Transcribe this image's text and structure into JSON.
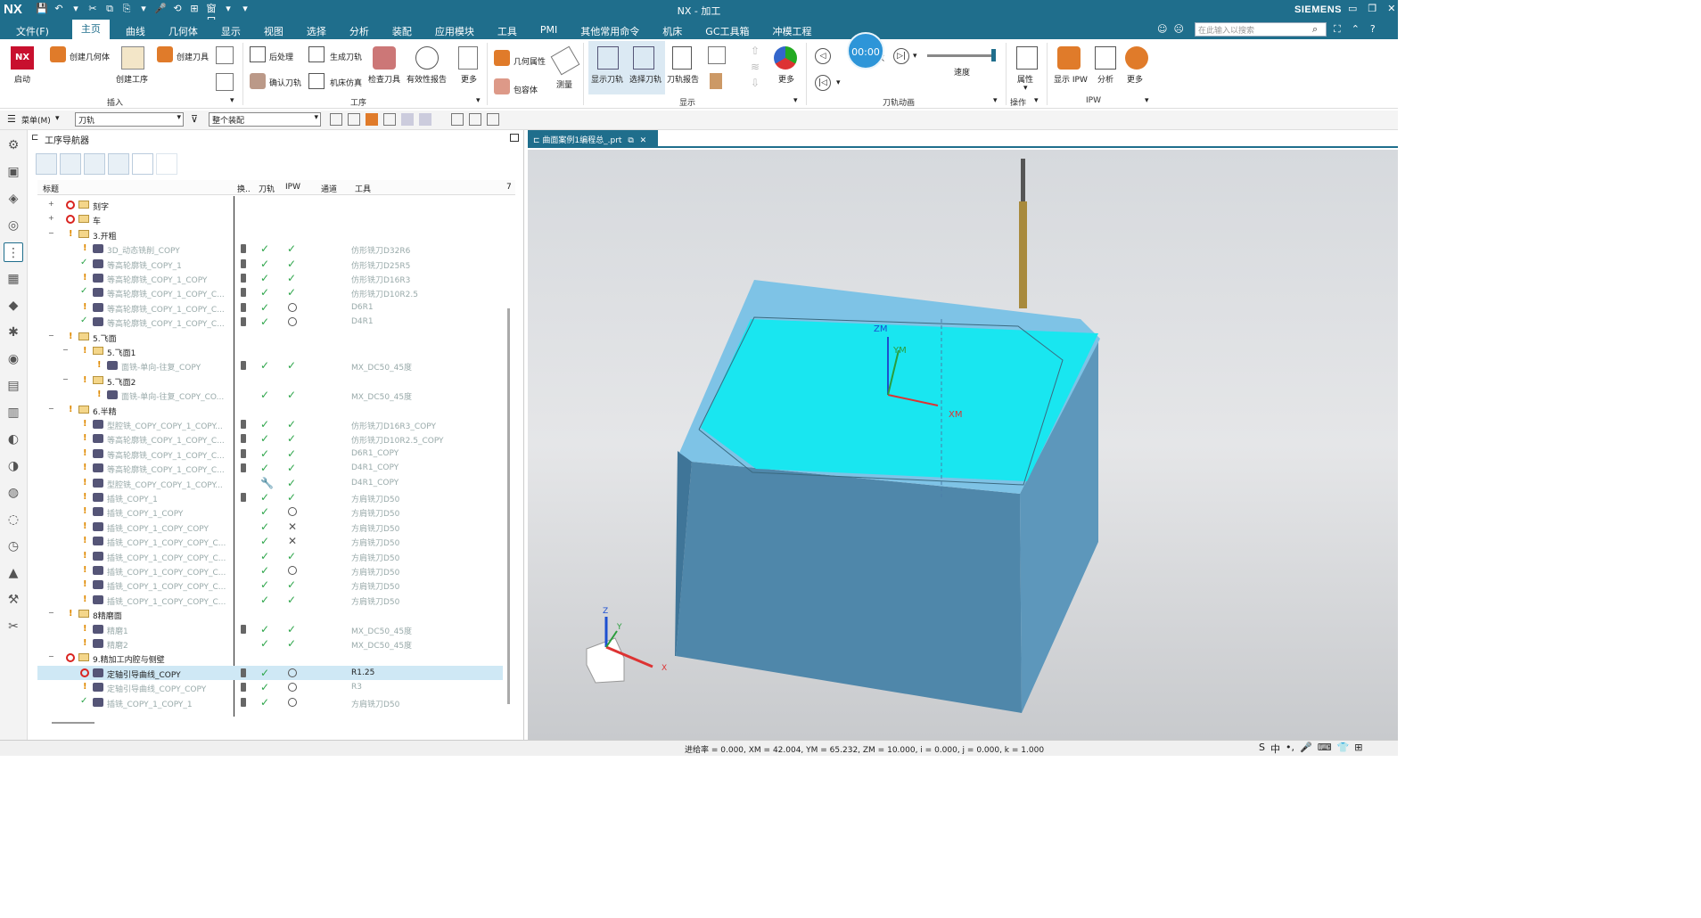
{
  "app": {
    "logo": "NX",
    "title": "NX - 加工",
    "brand": "SIEMENS",
    "window_controls": [
      "▭",
      "❐",
      "✕"
    ]
  },
  "quick_access": [
    "💾",
    "↶",
    "▾",
    "✂",
    "⧉",
    "⎘",
    "▾",
    "🎤",
    "⟲",
    "⊞",
    "窗口",
    "▾",
    "▾"
  ],
  "menu": {
    "items": [
      "文件(F)",
      "主页",
      "曲线",
      "几何体",
      "显示",
      "视图",
      "选择",
      "分析",
      "装配",
      "应用模块",
      "工具",
      "PMI",
      "其他常用命令",
      "机床",
      "GC工具箱",
      "冲模工程"
    ],
    "active": "主页",
    "timer": "00:00",
    "search_placeholder": "在此输入以搜索",
    "right_icons": [
      "☺",
      "☹"
    ],
    "right_icons2": [
      "⛶",
      "⌃",
      "?"
    ]
  },
  "ribbon": {
    "buttons": {
      "start": "启动",
      "create_geometry": "创建几何体",
      "create_operation": "创建工序",
      "create_tool": "创建刀具",
      "postprocess": "后处理",
      "generate_toolpath": "生成刀轨",
      "confirm_toolpath": "确认刀轨",
      "machine_sim": "机床仿真",
      "check_tool": "检查刀具",
      "valid_report": "有效性报告",
      "more1": "更多",
      "geom_props": "几何属性",
      "measure": "测量",
      "envelope": "包容体",
      "show_toolpath": "显示刀轨",
      "select_toolpath": "选择刀轨",
      "toolpath_report": "刀轨报告",
      "more2": "更多",
      "play": "播放",
      "speed": "速度",
      "properties": "属性",
      "show_ipw": "显示 IPW",
      "analyze": "分析",
      "more3": "更多"
    },
    "groups": {
      "insert": "插入",
      "operation": "工序",
      "display": "显示",
      "animation": "刀轨动画",
      "actions": "操作",
      "ipw": "IPW"
    }
  },
  "filterbar": {
    "menu": "菜单(M)",
    "filter1": "刀轨",
    "filter2": "整个装配"
  },
  "navigator": {
    "title": "工序导航器",
    "columns": [
      "标题",
      "换..",
      "刀轨",
      "IPW",
      "通道",
      "工具"
    ],
    "rows": [
      {
        "indent": 1,
        "expand": "+",
        "status": "noop",
        "icon": "fold",
        "name": "刻字",
        "dim": false,
        "bar": false,
        "path": "",
        "ipw": "",
        "tool": ""
      },
      {
        "indent": 1,
        "expand": "+",
        "status": "noop",
        "icon": "fold",
        "name": "车",
        "dim": false,
        "bar": false,
        "path": "",
        "ipw": "",
        "tool": ""
      },
      {
        "indent": 1,
        "expand": "−",
        "status": "exc",
        "icon": "fold",
        "name": "3.开粗",
        "dim": false,
        "bar": false,
        "path": "",
        "ipw": "",
        "tool": ""
      },
      {
        "indent": 2,
        "expand": "",
        "status": "exc",
        "icon": "op",
        "name": "3D_动态铣削_COPY",
        "dim": true,
        "bar": true,
        "path": "check",
        "ipw": "check",
        "tool": "仿形铣刀D32R6"
      },
      {
        "indent": 2,
        "expand": "",
        "status": "ok",
        "icon": "op",
        "name": "等高轮廓铣_COPY_1",
        "dim": true,
        "bar": true,
        "path": "check",
        "ipw": "check",
        "tool": "仿形铣刀D25R5"
      },
      {
        "indent": 2,
        "expand": "",
        "status": "exc",
        "icon": "op",
        "name": "等高轮廓铣_COPY_1_COPY",
        "dim": true,
        "bar": true,
        "path": "check",
        "ipw": "check",
        "tool": "仿形铣刀D16R3"
      },
      {
        "indent": 2,
        "expand": "",
        "status": "ok",
        "icon": "op",
        "name": "等高轮廓铣_COPY_1_COPY_C...",
        "dim": true,
        "bar": true,
        "path": "check",
        "ipw": "check",
        "tool": "仿形铣刀D10R2.5"
      },
      {
        "indent": 2,
        "expand": "",
        "status": "exc",
        "icon": "op",
        "name": "等高轮廓铣_COPY_1_COPY_C...",
        "dim": true,
        "bar": true,
        "path": "check",
        "ipw": "clock",
        "tool": "D6R1"
      },
      {
        "indent": 2,
        "expand": "",
        "status": "ok",
        "icon": "op",
        "name": "等高轮廓铣_COPY_1_COPY_C...",
        "dim": true,
        "bar": true,
        "path": "check",
        "ipw": "clock",
        "tool": "D4R1"
      },
      {
        "indent": 1,
        "expand": "−",
        "status": "exc",
        "icon": "fold",
        "name": "5.飞面",
        "dim": false,
        "bar": false,
        "path": "",
        "ipw": "",
        "tool": ""
      },
      {
        "indent": 2,
        "expand": "−",
        "status": "exc",
        "icon": "fold",
        "name": "5.飞面1",
        "dim": false,
        "bar": false,
        "path": "",
        "ipw": "",
        "tool": ""
      },
      {
        "indent": 3,
        "expand": "",
        "status": "exc",
        "icon": "op",
        "name": "面铣-单向-往复_COPY",
        "dim": true,
        "bar": true,
        "path": "check",
        "ipw": "check",
        "tool": "MX_DC50_45度"
      },
      {
        "indent": 2,
        "expand": "−",
        "status": "exc",
        "icon": "fold",
        "name": "5.飞面2",
        "dim": false,
        "bar": false,
        "path": "",
        "ipw": "",
        "tool": ""
      },
      {
        "indent": 3,
        "expand": "",
        "status": "exc",
        "icon": "op",
        "name": "面铣-单向-往复_COPY_CO...",
        "dim": true,
        "bar": false,
        "path": "check",
        "ipw": "check",
        "tool": "MX_DC50_45度"
      },
      {
        "indent": 1,
        "expand": "−",
        "status": "exc",
        "icon": "fold",
        "name": "6.半精",
        "dim": false,
        "bar": false,
        "path": "",
        "ipw": "",
        "tool": ""
      },
      {
        "indent": 2,
        "expand": "",
        "status": "exc",
        "icon": "op",
        "name": "型腔铣_COPY_COPY_1_COPY...",
        "dim": true,
        "bar": true,
        "path": "check",
        "ipw": "check",
        "tool": "仿形铣刀D16R3_COPY"
      },
      {
        "indent": 2,
        "expand": "",
        "status": "exc",
        "icon": "op",
        "name": "等高轮廓铣_COPY_1_COPY_C...",
        "dim": true,
        "bar": true,
        "path": "check",
        "ipw": "check",
        "tool": "仿形铣刀D10R2.5_COPY"
      },
      {
        "indent": 2,
        "expand": "",
        "status": "exc",
        "icon": "op",
        "name": "等高轮廓铣_COPY_1_COPY_C...",
        "dim": true,
        "bar": true,
        "path": "check",
        "ipw": "check",
        "tool": "D6R1_COPY"
      },
      {
        "indent": 2,
        "expand": "",
        "status": "exc",
        "icon": "op",
        "name": "等高轮廓铣_COPY_1_COPY_C...",
        "dim": true,
        "bar": true,
        "path": "check",
        "ipw": "check",
        "tool": "D4R1_COPY"
      },
      {
        "indent": 2,
        "expand": "",
        "status": "exc",
        "icon": "op",
        "name": "型腔铣_COPY_COPY_1_COPY...",
        "dim": true,
        "bar": false,
        "path": "wrench",
        "ipw": "check",
        "tool": "D4R1_COPY"
      },
      {
        "indent": 2,
        "expand": "",
        "status": "exc",
        "icon": "op",
        "name": "插铣_COPY_1",
        "dim": true,
        "bar": true,
        "path": "check",
        "ipw": "check",
        "tool": "方肩铣刀D50"
      },
      {
        "indent": 2,
        "expand": "",
        "status": "exc",
        "icon": "op",
        "name": "插铣_COPY_1_COPY",
        "dim": true,
        "bar": false,
        "path": "check",
        "ipw": "clock",
        "tool": "方肩铣刀D50"
      },
      {
        "indent": 2,
        "expand": "",
        "status": "exc",
        "icon": "op",
        "name": "插铣_COPY_1_COPY_COPY",
        "dim": true,
        "bar": false,
        "path": "check",
        "ipw": "x",
        "tool": "方肩铣刀D50"
      },
      {
        "indent": 2,
        "expand": "",
        "status": "exc",
        "icon": "op",
        "name": "插铣_COPY_1_COPY_COPY_C...",
        "dim": true,
        "bar": false,
        "path": "check",
        "ipw": "x",
        "tool": "方肩铣刀D50"
      },
      {
        "indent": 2,
        "expand": "",
        "status": "exc",
        "icon": "op",
        "name": "插铣_COPY_1_COPY_COPY_C...",
        "dim": true,
        "bar": false,
        "path": "check",
        "ipw": "check",
        "tool": "方肩铣刀D50"
      },
      {
        "indent": 2,
        "expand": "",
        "status": "exc",
        "icon": "op",
        "name": "插铣_COPY_1_COPY_COPY_C...",
        "dim": true,
        "bar": false,
        "path": "check",
        "ipw": "clock",
        "tool": "方肩铣刀D50"
      },
      {
        "indent": 2,
        "expand": "",
        "status": "exc",
        "icon": "op",
        "name": "插铣_COPY_1_COPY_COPY_C...",
        "dim": true,
        "bar": false,
        "path": "check",
        "ipw": "check",
        "tool": "方肩铣刀D50"
      },
      {
        "indent": 2,
        "expand": "",
        "status": "exc",
        "icon": "op",
        "name": "插铣_COPY_1_COPY_COPY_C...",
        "dim": true,
        "bar": false,
        "path": "check",
        "ipw": "check",
        "tool": "方肩铣刀D50"
      },
      {
        "indent": 1,
        "expand": "−",
        "status": "exc",
        "icon": "fold",
        "name": "8精磨面",
        "dim": false,
        "bar": false,
        "path": "",
        "ipw": "",
        "tool": ""
      },
      {
        "indent": 2,
        "expand": "",
        "status": "exc",
        "icon": "op",
        "name": "精磨1",
        "dim": true,
        "bar": true,
        "path": "check",
        "ipw": "check",
        "tool": "MX_DC50_45度"
      },
      {
        "indent": 2,
        "expand": "",
        "status": "exc",
        "icon": "op",
        "name": "精磨2",
        "dim": true,
        "bar": false,
        "path": "check",
        "ipw": "check",
        "tool": "MX_DC50_45度"
      },
      {
        "indent": 1,
        "expand": "−",
        "status": "noop",
        "icon": "fold",
        "name": "9.精加工内腔与侧壁",
        "dim": false,
        "bar": false,
        "path": "",
        "ipw": "",
        "tool": ""
      },
      {
        "indent": 2,
        "expand": "",
        "status": "noop",
        "icon": "op",
        "name": "定轴引导曲线_COPY",
        "dim": false,
        "bar": true,
        "path": "check",
        "ipw": "clock",
        "tool": "R1.25",
        "selected": true
      },
      {
        "indent": 2,
        "expand": "",
        "status": "exc",
        "icon": "op",
        "name": "定轴引导曲线_COPY_COPY",
        "dim": true,
        "bar": true,
        "path": "check",
        "ipw": "clock",
        "tool": "R3"
      },
      {
        "indent": 2,
        "expand": "",
        "status": "ok",
        "icon": "op",
        "name": "插铣_COPY_1_COPY_1",
        "dim": true,
        "bar": true,
        "path": "check",
        "ipw": "clock",
        "tool": "方肩铣刀D50"
      }
    ]
  },
  "viewport": {
    "tab": "曲面案例1编程总_.prt",
    "axes": {
      "zm": "ZM",
      "ym": "YM",
      "xm": "XM",
      "z": "Z",
      "y": "Y",
      "x": "X"
    }
  },
  "statusbar": {
    "text": "进给率 = 0.000, XM = 42.004, YM = 65.232, ZM = 10.000, i = 0.000, j = 0.000, k = 1.000",
    "ime": [
      "S",
      "中",
      "•,",
      "🎤",
      "⌨",
      "👕",
      "⊞"
    ]
  },
  "colors": {
    "theme": "#1f6e8c",
    "part_side": "#4f87aa",
    "part_top": "#7ec3e6",
    "cavity_floor": "#19e6f0",
    "check": "#2da54a",
    "noop": "#d9231f"
  }
}
